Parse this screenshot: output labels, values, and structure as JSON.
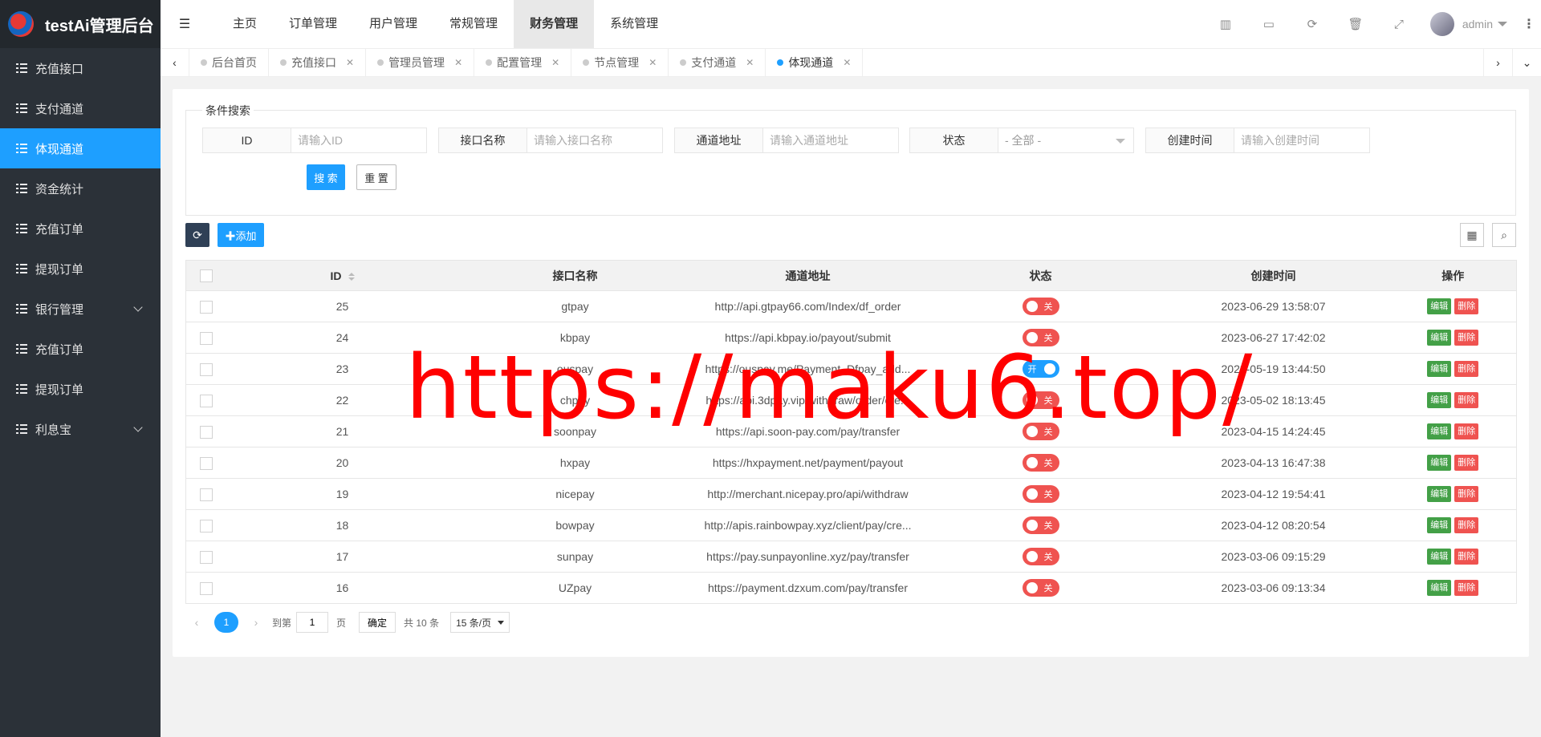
{
  "app": {
    "title": "testAi管理后台"
  },
  "sidebar": {
    "items": [
      {
        "label": "充值接口",
        "active": false,
        "chevron": false
      },
      {
        "label": "支付通道",
        "active": false,
        "chevron": false
      },
      {
        "label": "体现通道",
        "active": true,
        "chevron": false
      },
      {
        "label": "资金统计",
        "active": false,
        "chevron": false
      },
      {
        "label": "充值订单",
        "active": false,
        "chevron": false
      },
      {
        "label": "提现订单",
        "active": false,
        "chevron": false
      },
      {
        "label": "银行管理",
        "active": false,
        "chevron": true
      },
      {
        "label": "充值订单",
        "active": false,
        "chevron": false
      },
      {
        "label": "提现订单",
        "active": false,
        "chevron": false
      },
      {
        "label": "利息宝",
        "active": false,
        "chevron": true
      }
    ]
  },
  "header": {
    "menu": [
      "主页",
      "订单管理",
      "用户管理",
      "常规管理",
      "财务管理",
      "系统管理"
    ],
    "active_menu": "财务管理",
    "user_name": "admin"
  },
  "tabs": [
    {
      "label": "后台首页",
      "closable": false,
      "active": false
    },
    {
      "label": "充值接口",
      "closable": true,
      "active": false
    },
    {
      "label": "管理员管理",
      "closable": true,
      "active": false
    },
    {
      "label": "配置管理",
      "closable": true,
      "active": false
    },
    {
      "label": "节点管理",
      "closable": true,
      "active": false
    },
    {
      "label": "支付通道",
      "closable": true,
      "active": false
    },
    {
      "label": "体现通道",
      "closable": true,
      "active": true
    }
  ],
  "search": {
    "legend": "条件搜索",
    "fields": [
      {
        "label": "ID",
        "placeholder": "请输入ID"
      },
      {
        "label": "接口名称",
        "placeholder": "请输入接口名称"
      },
      {
        "label": "通道地址",
        "placeholder": "请输入通道地址"
      },
      {
        "label": "状态",
        "select_value": "- 全部 -"
      },
      {
        "label": "创建时间",
        "placeholder": "请输入创建时间"
      }
    ],
    "search_label": "搜 索",
    "reset_label": "重 置"
  },
  "toolbar": {
    "add_label": "添加"
  },
  "table": {
    "columns": [
      "ID",
      "接口名称",
      "通道地址",
      "状态",
      "创建时间",
      "操作"
    ],
    "edit_label": "编辑",
    "delete_label": "删除",
    "on_label": "开",
    "off_label": "关",
    "rows": [
      {
        "id": "25",
        "name": "gtpay",
        "url": "http://api.gtpay66.com/Index/df_order",
        "status": "off",
        "created": "2023-06-29 13:58:07"
      },
      {
        "id": "24",
        "name": "kbpay",
        "url": "https://api.kbpay.io/payout/submit",
        "status": "off",
        "created": "2023-06-27 17:42:02"
      },
      {
        "id": "23",
        "name": "ouspay",
        "url": "https://ouspay.me/Payment_Dfpay_add...",
        "status": "on",
        "created": "2023-05-19 13:44:50"
      },
      {
        "id": "22",
        "name": "chpay",
        "url": "https://api.3dpay.vip/withdraw/order/cre...",
        "status": "off",
        "created": "2023-05-02 18:13:45"
      },
      {
        "id": "21",
        "name": "soonpay",
        "url": "https://api.soon-pay.com/pay/transfer",
        "status": "off",
        "created": "2023-04-15 14:24:45"
      },
      {
        "id": "20",
        "name": "hxpay",
        "url": "https://hxpayment.net/payment/payout",
        "status": "off",
        "created": "2023-04-13 16:47:38"
      },
      {
        "id": "19",
        "name": "nicepay",
        "url": "http://merchant.nicepay.pro/api/withdraw",
        "status": "off",
        "created": "2023-04-12 19:54:41"
      },
      {
        "id": "18",
        "name": "bowpay",
        "url": "http://apis.rainbowpay.xyz/client/pay/cre...",
        "status": "off",
        "created": "2023-04-12 08:20:54"
      },
      {
        "id": "17",
        "name": "sunpay",
        "url": "https://pay.sunpayonline.xyz/pay/transfer",
        "status": "off",
        "created": "2023-03-06 09:15:29"
      },
      {
        "id": "16",
        "name": "UZpay",
        "url": "https://payment.dzxum.com/pay/transfer",
        "status": "off",
        "created": "2023-03-06 09:13:34"
      }
    ]
  },
  "pagination": {
    "current": "1",
    "goto_prefix": "到第",
    "goto_value": "1",
    "goto_suffix": "页",
    "confirm": "确定",
    "total": "共 10 条",
    "page_size": "15 条/页"
  },
  "watermark": "https://maku6.top/"
}
